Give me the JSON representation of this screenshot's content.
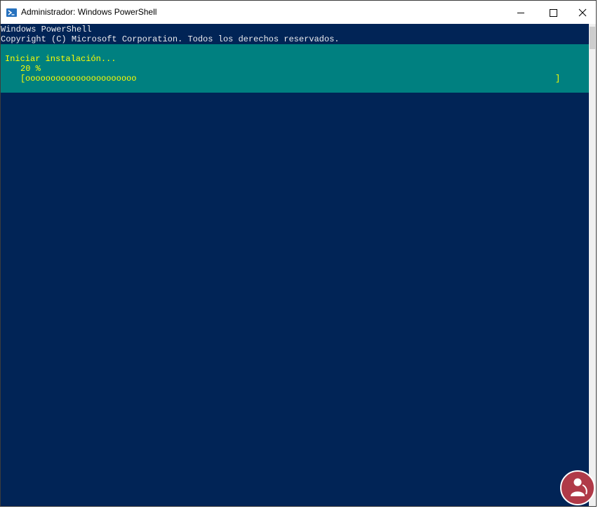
{
  "window": {
    "title": "Administrador: Windows PowerShell",
    "app_icon": "powershell-icon",
    "controls": [
      "minimize-icon",
      "maximize-icon",
      "close-icon"
    ]
  },
  "console": {
    "lines": [
      "Windows PowerShell",
      "Copyright (C) Microsoft Corporation. Todos los derechos reservados."
    ],
    "background_color": "#012456",
    "text_color": "#eeedf0"
  },
  "progress": {
    "activity": "Iniciar instalación...",
    "percent_label": "20 %",
    "bar_open": "[",
    "bar_fill": "oooooooooooooooooooooo",
    "bar_close": "]",
    "percent_value": 20,
    "panel_color": "#008080",
    "text_color": "#ffff00"
  },
  "watermark": {
    "icon": "solvetic-logo-icon"
  }
}
